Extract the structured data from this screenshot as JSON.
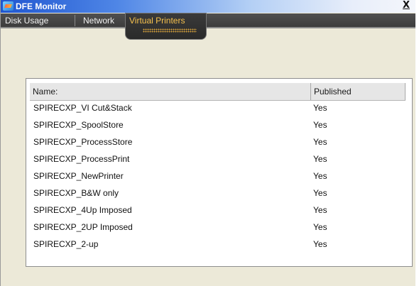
{
  "window": {
    "title": "DFE Monitor",
    "close_label": "X"
  },
  "tabs": [
    {
      "label": "Disk Usage",
      "active": false
    },
    {
      "label": "Network",
      "active": false
    },
    {
      "label": "Virtual Printers",
      "active": true
    }
  ],
  "table": {
    "columns": [
      "Name:",
      "Published"
    ],
    "rows": [
      {
        "name": "SPIRECXP_VI Cut&Stack",
        "published": "Yes"
      },
      {
        "name": "SPIRECXP_SpoolStore",
        "published": "Yes"
      },
      {
        "name": "SPIRECXP_ProcessStore",
        "published": "Yes"
      },
      {
        "name": "SPIRECXP_ProcessPrint",
        "published": "Yes"
      },
      {
        "name": "SPIRECXP_NewPrinter",
        "published": "Yes"
      },
      {
        "name": "SPIRECXP_B&W only",
        "published": "Yes"
      },
      {
        "name": "SPIRECXP_4Up Imposed",
        "published": "Yes"
      },
      {
        "name": "SPIRECXP_2UP Imposed",
        "published": "Yes"
      },
      {
        "name": "SPIRECXP_2-up",
        "published": "Yes"
      }
    ]
  },
  "colors": {
    "titlebar": "#1f56d0",
    "tabstrip": "#3b3b3b",
    "active_tab_text": "#f5c04d"
  },
  "icons": {
    "app": "dfe-monitor-icon",
    "close": "close-icon"
  }
}
